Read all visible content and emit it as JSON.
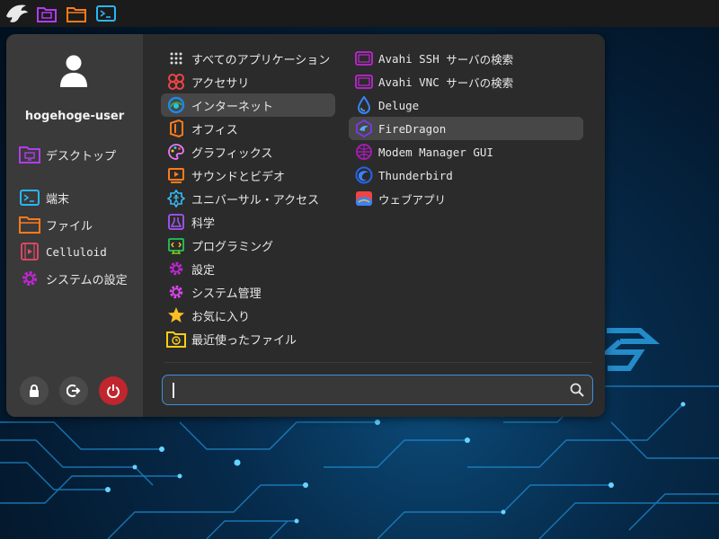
{
  "taskbar": {
    "icons": [
      "garuda-eagle-icon",
      "folder-purple-icon",
      "folder-orange-icon",
      "terminal-icon"
    ]
  },
  "menu": {
    "user": {
      "name": "hogehoge-user"
    },
    "favorites": [
      {
        "label": "デスクトップ",
        "icon": "desktop-folder-icon"
      },
      {
        "label": "端末",
        "icon": "terminal-icon"
      },
      {
        "label": "ファイル",
        "icon": "files-folder-icon"
      },
      {
        "label": "Celluloid",
        "icon": "celluloid-icon"
      },
      {
        "label": "システムの設定",
        "icon": "settings-gear-icon"
      }
    ],
    "actions": [
      "lock-icon",
      "logout-icon",
      "power-icon"
    ],
    "categories": [
      {
        "label": "すべてのアプリケーション",
        "icon": "grid-icon"
      },
      {
        "label": "アクセサリ",
        "icon": "accessories-icon"
      },
      {
        "label": "インターネット",
        "icon": "internet-icon",
        "selected": true
      },
      {
        "label": "オフィス",
        "icon": "office-icon"
      },
      {
        "label": "グラフィックス",
        "icon": "graphics-icon"
      },
      {
        "label": "サウンドとビデオ",
        "icon": "multimedia-icon"
      },
      {
        "label": "ユニバーサル・アクセス",
        "icon": "accessibility-icon"
      },
      {
        "label": "科学",
        "icon": "science-icon"
      },
      {
        "label": "プログラミング",
        "icon": "programming-icon"
      },
      {
        "label": "設定",
        "icon": "settings-gear-icon"
      },
      {
        "label": "システム管理",
        "icon": "system-gear-icon"
      },
      {
        "label": "お気に入り",
        "icon": "star-icon"
      },
      {
        "label": "最近使ったファイル",
        "icon": "recent-folder-icon"
      }
    ],
    "apps": [
      {
        "name": "Avahi SSH",
        "suffix": "サーバの検索",
        "icon": "avahi-ssh-icon"
      },
      {
        "name": "Avahi VNC",
        "suffix": "サーバの検索",
        "icon": "avahi-vnc-icon"
      },
      {
        "name": "Deluge",
        "suffix": "",
        "icon": "deluge-icon"
      },
      {
        "name": "FireDragon",
        "suffix": "",
        "icon": "firedragon-icon",
        "selected": true
      },
      {
        "name": "Modem Manager GUI",
        "suffix": "",
        "icon": "modem-manager-icon"
      },
      {
        "name": "Thunderbird",
        "suffix": "",
        "icon": "thunderbird-icon"
      },
      {
        "name": "",
        "suffix": "ウェブアプリ",
        "icon": "webapps-icon"
      }
    ],
    "search": {
      "value": "",
      "placeholder": ""
    }
  },
  "colors": {
    "accent": "#3d8fe0",
    "power": "#c0262d",
    "panel": "#2b2b2b",
    "sidebar": "#3a3a3a"
  }
}
